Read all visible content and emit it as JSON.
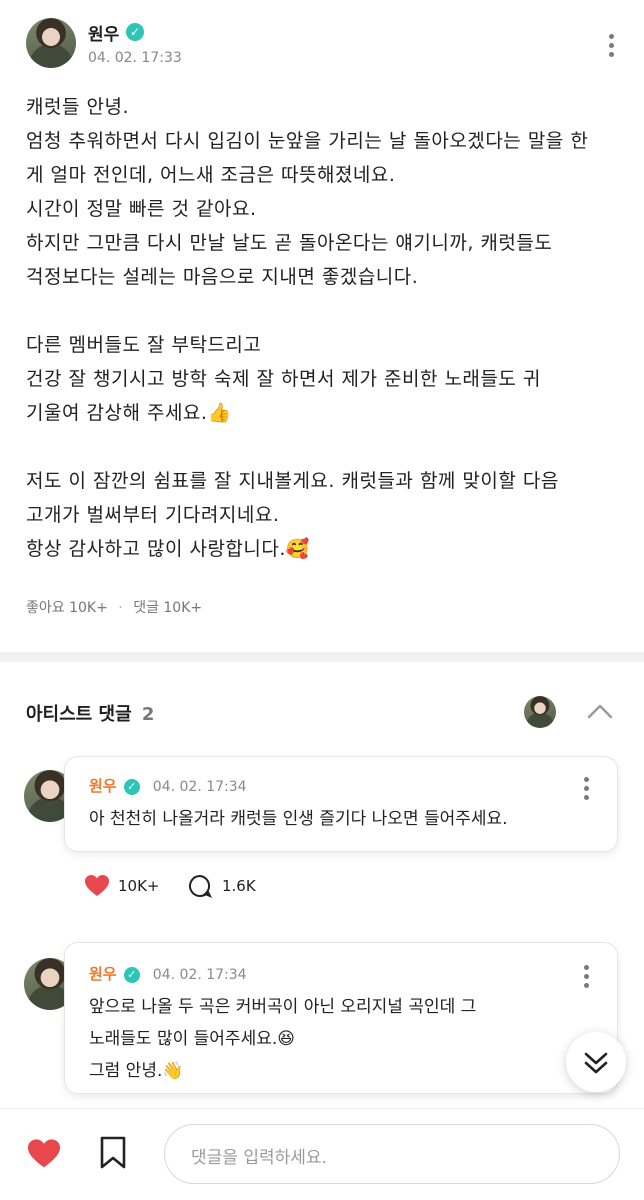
{
  "post": {
    "author": "원우",
    "timestamp": "04. 02. 17:33",
    "lines": [
      "캐럿들 안녕.",
      "엄청 추워하면서 다시 입김이 눈앞을 가리는 날 돌아오겠다는 말을 한",
      "게 얼마 전인데, 어느새 조금은 따뜻해졌네요.",
      "시간이 정말 빠른 것 같아요.",
      "하지만 그만큼 다시 만날 날도 곧 돌아온다는 얘기니까, 캐럿들도",
      "걱정보다는 설레는 마음으로 지내면 좋겠습니다.",
      "",
      "다른 멤버들도 잘 부탁드리고",
      "건강 잘 챙기시고 방학 숙제 잘 하면서 제가 준비한 노래들도 귀",
      "기울여 감상해 주세요.👍",
      "",
      "저도 이 잠깐의 쉼표를 잘 지내볼게요. 캐럿들과 함께 맞이할 다음",
      "고개가 벌써부터 기다려지네요.",
      "항상 감사하고 많이 사랑합니다.🥰"
    ],
    "likes_label": "좋아요 10K+",
    "separator": "·",
    "comments_label": "댓글 10K+"
  },
  "artist_comments": {
    "title": "아티스트 댓글",
    "count": "2"
  },
  "comments": [
    {
      "author": "원우",
      "timestamp": "04. 02. 17:34",
      "text": "아 천천히 나올거라 캐럿들 인생 즐기다 나오면 들어주세요.",
      "likes": "10K+",
      "replies": "1.6K"
    },
    {
      "author": "원우",
      "timestamp": "04. 02. 17:34",
      "text": "앞으로 나올 두 곡은 커버곡이 아닌 오리지널 곡인데 그\n노래들도 많이 들어주세요.😆\n그럼 안녕.👋"
    }
  ],
  "bottom_bar": {
    "input_placeholder": "댓글을 입력하세요."
  },
  "colors": {
    "accent_orange": "#f07a2a",
    "verified_teal": "#2ec4b6",
    "heart_red": "#e8474e"
  }
}
